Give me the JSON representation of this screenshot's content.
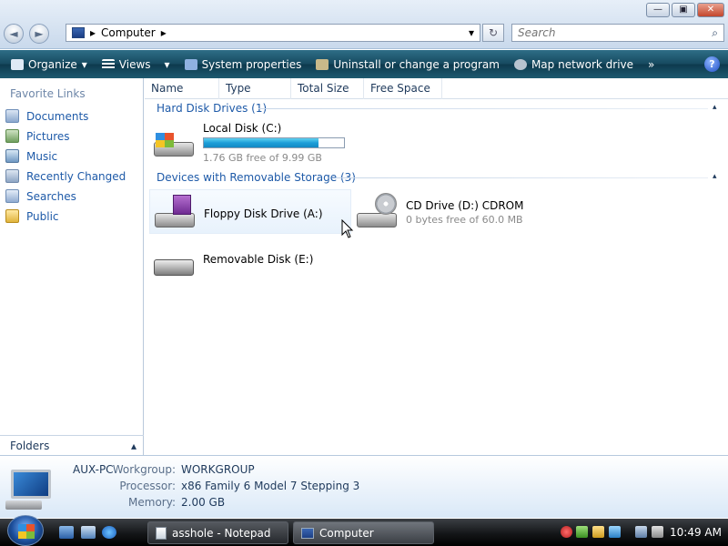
{
  "window": {
    "btn_minimize": "—",
    "btn_maximize": "▣",
    "btn_close": "✕"
  },
  "nav": {
    "back": "◄",
    "forward": "►"
  },
  "address": {
    "path": "Computer",
    "sep_left": "▸",
    "sep_right": "▸",
    "dropdown": "▾",
    "refresh": "↻"
  },
  "search": {
    "placeholder": "Search",
    "icon": "⌕"
  },
  "toolbar": {
    "items": [
      {
        "label": "Organize",
        "arrow": "▾"
      },
      {
        "label": "Views",
        "arrow": "▾"
      },
      {
        "label": "System properties"
      },
      {
        "label": "Uninstall or change a program"
      },
      {
        "label": "Map network drive"
      }
    ],
    "more": "»",
    "help": "?"
  },
  "favorites": {
    "title": "Favorite Links",
    "items": [
      {
        "label": "Documents",
        "icon": "documents-icon"
      },
      {
        "label": "Pictures",
        "icon": "pictures-icon"
      },
      {
        "label": "Music",
        "icon": "music-icon"
      },
      {
        "label": "Recently Changed",
        "icon": "recent-icon"
      },
      {
        "label": "Searches",
        "icon": "searches-icon"
      },
      {
        "label": "Public",
        "icon": "public-folder-icon"
      }
    ]
  },
  "folders": {
    "label": "Folders",
    "caret": "▴"
  },
  "columns": [
    "Name",
    "Type",
    "Total Size",
    "Free Space"
  ],
  "groups": {
    "hard": {
      "title": "Hard Disk Drives (1)",
      "caret": "▴",
      "drives": [
        {
          "name": "Local Disk (C:)",
          "free": "1.76 GB free of 9.99 GB",
          "used_fraction": 0.82
        }
      ]
    },
    "removable": {
      "title": "Devices with Removable Storage (3)",
      "caret": "▴",
      "drives": [
        {
          "name": "Floppy Disk Drive (A:)"
        },
        {
          "name": "CD Drive (D:) CDROM",
          "free": "0 bytes free of 60.0 MB"
        },
        {
          "name": "Removable Disk (E:)"
        }
      ]
    }
  },
  "details": {
    "computer_name": "AUX-PC",
    "workgroup_label": "Workgroup:",
    "workgroup": "WORKGROUP",
    "processor_label": "Processor:",
    "processor": "x86 Family 6 Model 7 Stepping 3",
    "memory_label": "Memory:",
    "memory": "2.00 GB"
  },
  "taskbar": {
    "tasks": [
      {
        "label": "asshole - Notepad"
      },
      {
        "label": "Computer"
      }
    ],
    "clock": "10:49 AM"
  },
  "colors": {
    "accent": "#1e5aa8",
    "toolbar": "#174a60",
    "progress": "#1d9ed8"
  }
}
